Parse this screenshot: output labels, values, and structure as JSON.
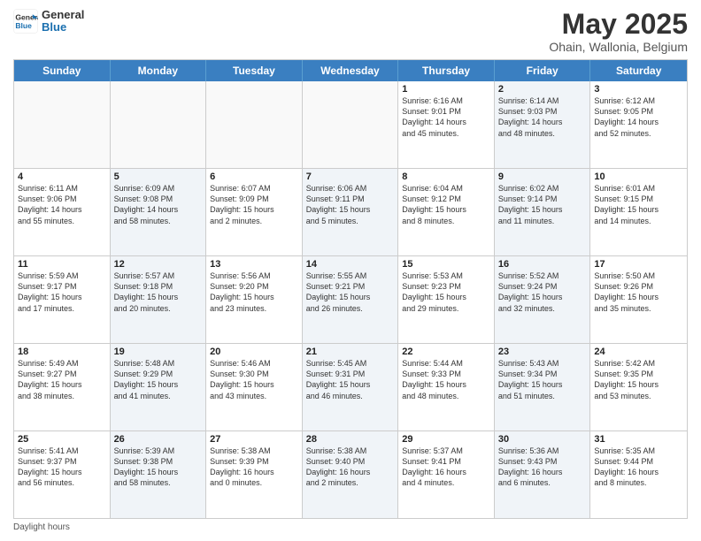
{
  "header": {
    "logo_line1": "General",
    "logo_line2": "Blue",
    "month_year": "May 2025",
    "location": "Ohain, Wallonia, Belgium"
  },
  "days_of_week": [
    "Sunday",
    "Monday",
    "Tuesday",
    "Wednesday",
    "Thursday",
    "Friday",
    "Saturday"
  ],
  "rows": [
    [
      {
        "day": "",
        "text": "",
        "shaded": false,
        "empty": true
      },
      {
        "day": "",
        "text": "",
        "shaded": false,
        "empty": true
      },
      {
        "day": "",
        "text": "",
        "shaded": false,
        "empty": true
      },
      {
        "day": "",
        "text": "",
        "shaded": false,
        "empty": true
      },
      {
        "day": "1",
        "text": "Sunrise: 6:16 AM\nSunset: 9:01 PM\nDaylight: 14 hours\nand 45 minutes.",
        "shaded": false,
        "empty": false
      },
      {
        "day": "2",
        "text": "Sunrise: 6:14 AM\nSunset: 9:03 PM\nDaylight: 14 hours\nand 48 minutes.",
        "shaded": true,
        "empty": false
      },
      {
        "day": "3",
        "text": "Sunrise: 6:12 AM\nSunset: 9:05 PM\nDaylight: 14 hours\nand 52 minutes.",
        "shaded": false,
        "empty": false
      }
    ],
    [
      {
        "day": "4",
        "text": "Sunrise: 6:11 AM\nSunset: 9:06 PM\nDaylight: 14 hours\nand 55 minutes.",
        "shaded": false,
        "empty": false
      },
      {
        "day": "5",
        "text": "Sunrise: 6:09 AM\nSunset: 9:08 PM\nDaylight: 14 hours\nand 58 minutes.",
        "shaded": true,
        "empty": false
      },
      {
        "day": "6",
        "text": "Sunrise: 6:07 AM\nSunset: 9:09 PM\nDaylight: 15 hours\nand 2 minutes.",
        "shaded": false,
        "empty": false
      },
      {
        "day": "7",
        "text": "Sunrise: 6:06 AM\nSunset: 9:11 PM\nDaylight: 15 hours\nand 5 minutes.",
        "shaded": true,
        "empty": false
      },
      {
        "day": "8",
        "text": "Sunrise: 6:04 AM\nSunset: 9:12 PM\nDaylight: 15 hours\nand 8 minutes.",
        "shaded": false,
        "empty": false
      },
      {
        "day": "9",
        "text": "Sunrise: 6:02 AM\nSunset: 9:14 PM\nDaylight: 15 hours\nand 11 minutes.",
        "shaded": true,
        "empty": false
      },
      {
        "day": "10",
        "text": "Sunrise: 6:01 AM\nSunset: 9:15 PM\nDaylight: 15 hours\nand 14 minutes.",
        "shaded": false,
        "empty": false
      }
    ],
    [
      {
        "day": "11",
        "text": "Sunrise: 5:59 AM\nSunset: 9:17 PM\nDaylight: 15 hours\nand 17 minutes.",
        "shaded": false,
        "empty": false
      },
      {
        "day": "12",
        "text": "Sunrise: 5:57 AM\nSunset: 9:18 PM\nDaylight: 15 hours\nand 20 minutes.",
        "shaded": true,
        "empty": false
      },
      {
        "day": "13",
        "text": "Sunrise: 5:56 AM\nSunset: 9:20 PM\nDaylight: 15 hours\nand 23 minutes.",
        "shaded": false,
        "empty": false
      },
      {
        "day": "14",
        "text": "Sunrise: 5:55 AM\nSunset: 9:21 PM\nDaylight: 15 hours\nand 26 minutes.",
        "shaded": true,
        "empty": false
      },
      {
        "day": "15",
        "text": "Sunrise: 5:53 AM\nSunset: 9:23 PM\nDaylight: 15 hours\nand 29 minutes.",
        "shaded": false,
        "empty": false
      },
      {
        "day": "16",
        "text": "Sunrise: 5:52 AM\nSunset: 9:24 PM\nDaylight: 15 hours\nand 32 minutes.",
        "shaded": true,
        "empty": false
      },
      {
        "day": "17",
        "text": "Sunrise: 5:50 AM\nSunset: 9:26 PM\nDaylight: 15 hours\nand 35 minutes.",
        "shaded": false,
        "empty": false
      }
    ],
    [
      {
        "day": "18",
        "text": "Sunrise: 5:49 AM\nSunset: 9:27 PM\nDaylight: 15 hours\nand 38 minutes.",
        "shaded": false,
        "empty": false
      },
      {
        "day": "19",
        "text": "Sunrise: 5:48 AM\nSunset: 9:29 PM\nDaylight: 15 hours\nand 41 minutes.",
        "shaded": true,
        "empty": false
      },
      {
        "day": "20",
        "text": "Sunrise: 5:46 AM\nSunset: 9:30 PM\nDaylight: 15 hours\nand 43 minutes.",
        "shaded": false,
        "empty": false
      },
      {
        "day": "21",
        "text": "Sunrise: 5:45 AM\nSunset: 9:31 PM\nDaylight: 15 hours\nand 46 minutes.",
        "shaded": true,
        "empty": false
      },
      {
        "day": "22",
        "text": "Sunrise: 5:44 AM\nSunset: 9:33 PM\nDaylight: 15 hours\nand 48 minutes.",
        "shaded": false,
        "empty": false
      },
      {
        "day": "23",
        "text": "Sunrise: 5:43 AM\nSunset: 9:34 PM\nDaylight: 15 hours\nand 51 minutes.",
        "shaded": true,
        "empty": false
      },
      {
        "day": "24",
        "text": "Sunrise: 5:42 AM\nSunset: 9:35 PM\nDaylight: 15 hours\nand 53 minutes.",
        "shaded": false,
        "empty": false
      }
    ],
    [
      {
        "day": "25",
        "text": "Sunrise: 5:41 AM\nSunset: 9:37 PM\nDaylight: 15 hours\nand 56 minutes.",
        "shaded": false,
        "empty": false
      },
      {
        "day": "26",
        "text": "Sunrise: 5:39 AM\nSunset: 9:38 PM\nDaylight: 15 hours\nand 58 minutes.",
        "shaded": true,
        "empty": false
      },
      {
        "day": "27",
        "text": "Sunrise: 5:38 AM\nSunset: 9:39 PM\nDaylight: 16 hours\nand 0 minutes.",
        "shaded": false,
        "empty": false
      },
      {
        "day": "28",
        "text": "Sunrise: 5:38 AM\nSunset: 9:40 PM\nDaylight: 16 hours\nand 2 minutes.",
        "shaded": true,
        "empty": false
      },
      {
        "day": "29",
        "text": "Sunrise: 5:37 AM\nSunset: 9:41 PM\nDaylight: 16 hours\nand 4 minutes.",
        "shaded": false,
        "empty": false
      },
      {
        "day": "30",
        "text": "Sunrise: 5:36 AM\nSunset: 9:43 PM\nDaylight: 16 hours\nand 6 minutes.",
        "shaded": true,
        "empty": false
      },
      {
        "day": "31",
        "text": "Sunrise: 5:35 AM\nSunset: 9:44 PM\nDaylight: 16 hours\nand 8 minutes.",
        "shaded": false,
        "empty": false
      }
    ]
  ],
  "footer": {
    "note": "Daylight hours"
  }
}
